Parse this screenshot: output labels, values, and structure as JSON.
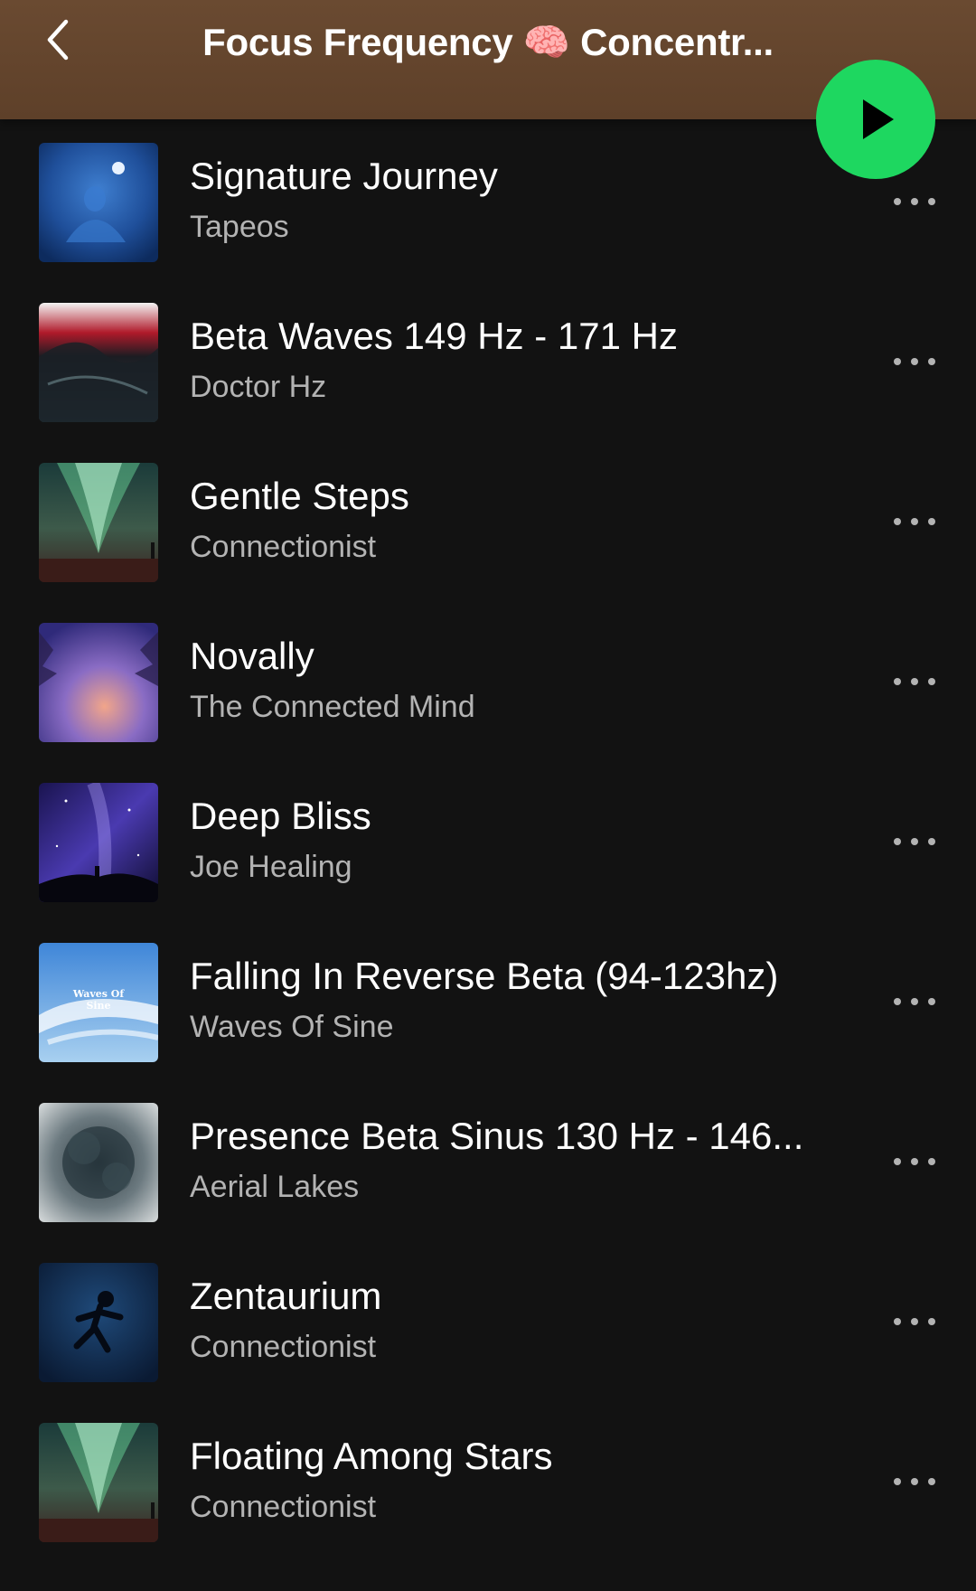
{
  "header": {
    "back_icon": "chevron-left-icon",
    "title": "Focus Frequency 🧠 Concentr...",
    "play_icon": "play-icon",
    "background_color": "#6a4a31"
  },
  "accent_color": "#1ed760",
  "tracks": [
    {
      "title": "Signature Journey",
      "artist": "Tapeos",
      "more_icon": "more-horizontal-icon"
    },
    {
      "title": "Beta Waves 149 Hz - 171 Hz",
      "artist": "Doctor Hz",
      "more_icon": "more-horizontal-icon"
    },
    {
      "title": "Gentle Steps",
      "artist": "Connectionist",
      "more_icon": "more-horizontal-icon"
    },
    {
      "title": "Novally",
      "artist": "The Connected Mind",
      "more_icon": "more-horizontal-icon"
    },
    {
      "title": "Deep Bliss",
      "artist": "Joe Healing",
      "more_icon": "more-horizontal-icon"
    },
    {
      "title": "Falling In Reverse Beta (94-123hz)",
      "artist": "Waves Of Sine",
      "more_icon": "more-horizontal-icon",
      "cover_text": "Waves Of Sine"
    },
    {
      "title": "Presence Beta Sinus 130 Hz - 146...",
      "artist": "Aerial Lakes",
      "more_icon": "more-horizontal-icon"
    },
    {
      "title": "Zentaurium",
      "artist": "Connectionist",
      "more_icon": "more-horizontal-icon"
    },
    {
      "title": "Floating Among Stars",
      "artist": "Connectionist",
      "more_icon": "more-horizontal-icon"
    }
  ]
}
